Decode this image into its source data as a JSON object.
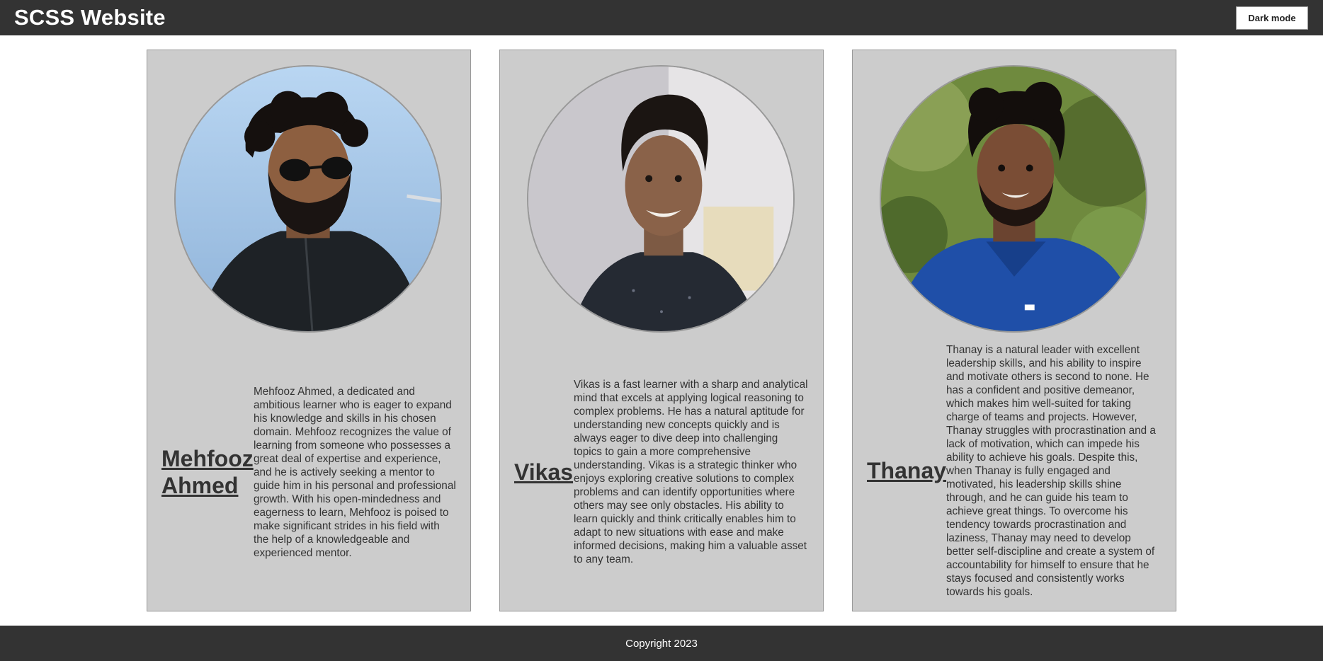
{
  "header": {
    "title": "SCSS Website",
    "dark_mode_label": "Dark mode"
  },
  "cards": [
    {
      "name": "Mehfooz Ahmed",
      "bio": "Mehfooz Ahmed, a dedicated and ambitious learner who is eager to expand his knowledge and skills in his chosen domain. Mehfooz recognizes the value of learning from someone who possesses a great deal of expertise and experience, and he is actively seeking a mentor to guide him in his personal and professional growth. With his open-mindedness and eagerness to learn, Mehfooz is poised to make significant strides in his field with the help of a knowledgeable and experienced mentor.",
      "photo": "profile-photo-mehfooz"
    },
    {
      "name": "Vikas",
      "bio": "Vikas is a fast learner with a sharp and analytical mind that excels at applying logical reasoning to complex problems. He has a natural aptitude for understanding new concepts quickly and is always eager to dive deep into challenging topics to gain a more comprehensive understanding. Vikas is a strategic thinker who enjoys exploring creative solutions to complex problems and can identify opportunities where others may see only obstacles. His ability to learn quickly and think critically enables him to adapt to new situations with ease and make informed decisions, making him a valuable asset to any team.",
      "photo": "profile-photo-vikas"
    },
    {
      "name": "Thanay",
      "bio": "Thanay is a natural leader with excellent leadership skills, and his ability to inspire and motivate others is second to none. He has a confident and positive demeanor, which makes him well-suited for taking charge of teams and projects. However, Thanay struggles with procrastination and a lack of motivation, which can impede his ability to achieve his goals. Despite this, when Thanay is fully engaged and motivated, his leadership skills shine through, and he can guide his team to achieve great things. To overcome his tendency towards procrastination and laziness, Thanay may need to develop better self-discipline and create a system of accountability for himself to ensure that he stays focused and consistently works towards his goals.",
      "photo": "profile-photo-thanay"
    }
  ],
  "footer": {
    "copyright": "Copyright 2023"
  },
  "colors": {
    "header_bg": "#333333",
    "card_bg": "#cccccc",
    "card_border": "#999999"
  }
}
